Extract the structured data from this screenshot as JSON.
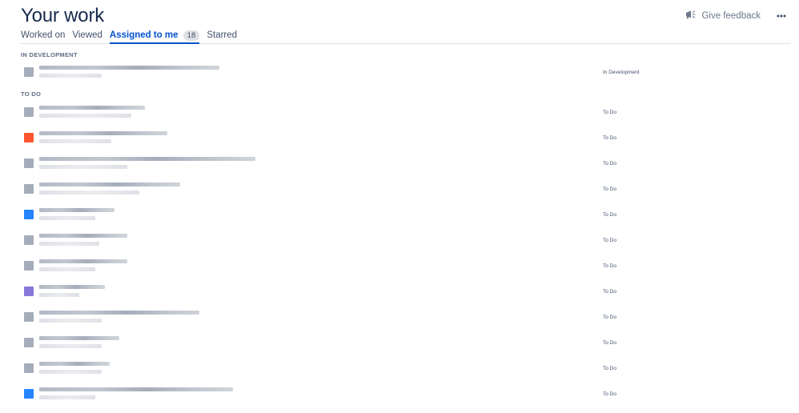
{
  "page": {
    "title": "Your work"
  },
  "header": {
    "feedback_label": "Give feedback",
    "feedback_icon": "megaphone-icon",
    "more_icon": "more-icon"
  },
  "tabs": [
    {
      "label": "Worked on"
    },
    {
      "label": "Viewed"
    },
    {
      "label": "Assigned to me",
      "count": "18",
      "active": true
    },
    {
      "label": "Starred"
    }
  ],
  "sections": [
    {
      "title": "IN DEVELOPMENT",
      "items": [
        {
          "status": "In Development",
          "icon_color": "#a5adba"
        }
      ]
    },
    {
      "title": "TO DO",
      "items": [
        {
          "status": "To Do",
          "icon_color": "#a5adba"
        },
        {
          "status": "To Do",
          "icon_color": "#ff5630"
        },
        {
          "status": "To Do",
          "icon_color": "#a5adba"
        },
        {
          "status": "To Do",
          "icon_color": "#a5adba"
        },
        {
          "status": "To Do",
          "icon_color": "#2684ff"
        },
        {
          "status": "To Do",
          "icon_color": "#a5adba"
        },
        {
          "status": "To Do",
          "icon_color": "#a5adba"
        },
        {
          "status": "To Do",
          "icon_color": "#8777d9"
        },
        {
          "status": "To Do",
          "icon_color": "#a5adba"
        },
        {
          "status": "To Do",
          "icon_color": "#a5adba"
        },
        {
          "status": "To Do",
          "icon_color": "#a5adba"
        },
        {
          "status": "To Do",
          "icon_color": "#2684ff"
        }
      ]
    }
  ]
}
